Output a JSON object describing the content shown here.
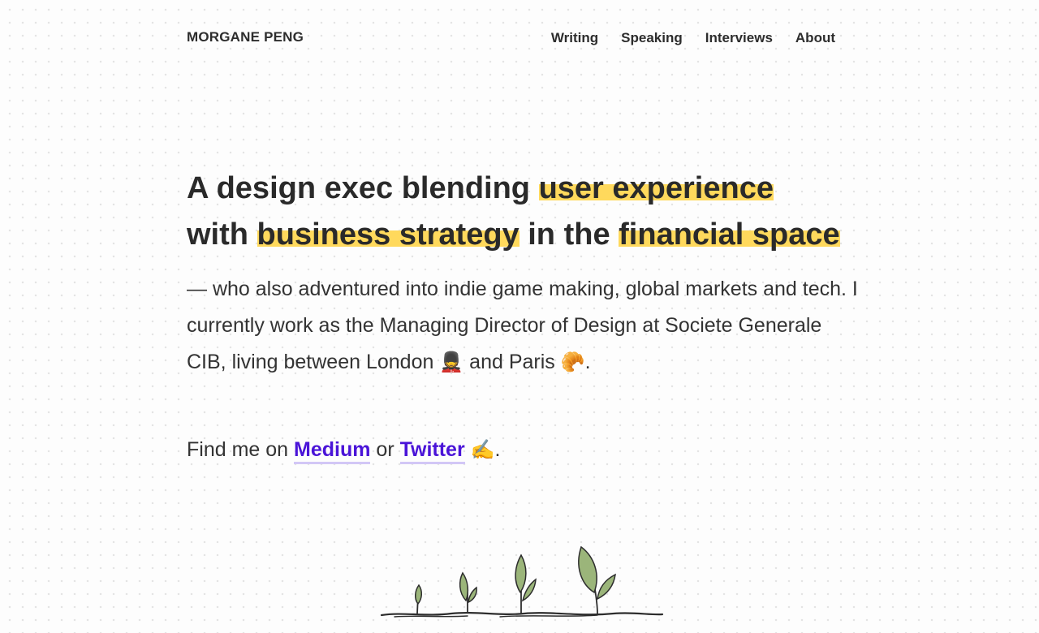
{
  "site": {
    "name": "MORGANE PENG"
  },
  "nav": {
    "items": [
      "Writing",
      "Speaking",
      "Interviews",
      "About"
    ]
  },
  "hero": {
    "line1_text": "A design exec blending ",
    "line1_hl": "user experience",
    "line2_text1": "with ",
    "line2_hl1": "business strategy",
    "line2_text2": " in the ",
    "line2_hl2": "financial space"
  },
  "intro": {
    "text": "— who also adventured into indie game making, global markets and tech. I currently work as the Managing Director of Design at Societe Generale CIB, living between London ",
    "london_emoji": "💂",
    "middle": " and Paris ",
    "paris_emoji": "🥐",
    "end": "."
  },
  "find": {
    "prefix": "Find me on ",
    "medium": "Medium",
    "or": " or ",
    "twitter": "Twitter",
    "emoji": "✍️",
    "end": "."
  },
  "colors": {
    "highlight": "#ffd95c",
    "link": "#4a14d8",
    "link_underline": "#d2c7f6",
    "leaf": "#9bb57a"
  },
  "illustration": {
    "icon": "sprouting-plants-icon"
  }
}
